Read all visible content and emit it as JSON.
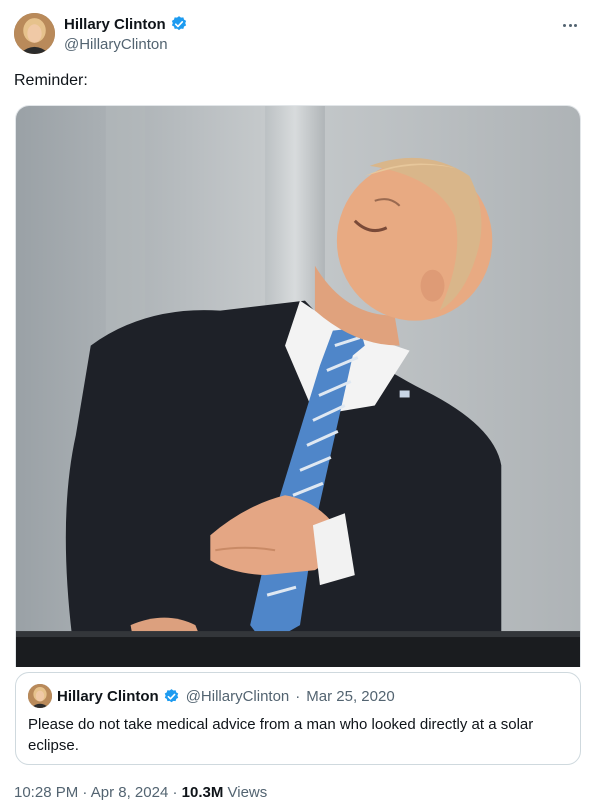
{
  "author": {
    "name": "Hillary Clinton",
    "handle": "@HillaryClinton",
    "verified": true
  },
  "tweet": {
    "text": "Reminder:",
    "media_description": "Photo of a man in a dark suit and blue striped tie looking up at the sky with a hand on his chest"
  },
  "quote": {
    "name": "Hillary Clinton",
    "handle": "@HillaryClinton",
    "separator": "·",
    "date": "Mar 25, 2020",
    "text": "Please do not take medical advice from a man who looked directly at a solar eclipse."
  },
  "meta": {
    "time": "10:28 PM",
    "date": "Apr 8, 2024",
    "separator": "·",
    "views_count": "10.3M",
    "views_label": "Views"
  },
  "colors": {
    "verified_blue": "#1d9bf0",
    "secondary_text": "#536471",
    "primary_text": "#0f1419"
  },
  "icons": {
    "more": "more-icon",
    "verified": "verified-badge-icon"
  }
}
